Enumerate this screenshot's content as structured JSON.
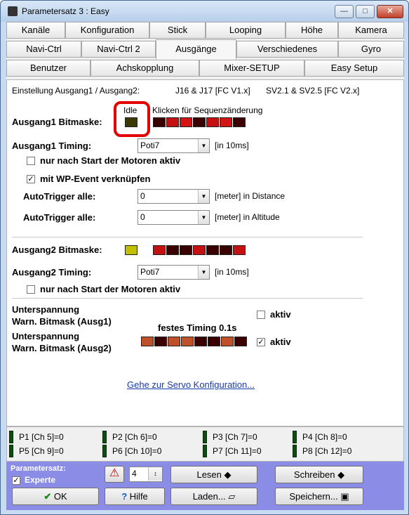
{
  "window": {
    "title": "Parametersatz 3 : Easy"
  },
  "tabs": {
    "row1": [
      "Kanäle",
      "Konfiguration",
      "Stick",
      "Looping",
      "Höhe",
      "Kamera"
    ],
    "row2": [
      "Navi-Ctrl",
      "Navi-Ctrl 2",
      "Ausgänge",
      "Verschiedenes",
      "Gyro"
    ],
    "row3": [
      "Benutzer",
      "Achskopplung",
      "Mixer-SETUP",
      "Easy Setup"
    ],
    "selected": "Ausgänge"
  },
  "panel": {
    "info_left": "Einstellung Ausgang1 / Ausgang2:",
    "info_mid": "J16 & J17 [FC V1.x]",
    "info_right": "SV2.1 & SV2.5 [FC V2.x]",
    "idle_label": "Idle",
    "seq_hint": "Klicken für Sequenzänderung",
    "a1_mask_label": "Ausgang1 Bitmaske:",
    "a1_timing_label": "Ausgang1 Timing:",
    "a1_timing_value": "Poti7",
    "timing_unit": "[in 10ms]",
    "a1_only_motors": "nur nach Start der Motoren aktiv",
    "a1_only_motors_checked": false,
    "wp_event": "mit WP-Event verknüpfen",
    "wp_event_checked": true,
    "autotrigger1_label": "AutoTrigger alle:",
    "autotrigger1_value": "0",
    "autotrigger1_unit": "[meter] in Distance",
    "autotrigger2_label": "AutoTrigger alle:",
    "autotrigger2_value": "0",
    "autotrigger2_unit": "[meter] in Altitude",
    "a2_mask_label": "Ausgang2 Bitmaske:",
    "a2_timing_label": "Ausgang2 Timing:",
    "a2_timing_value": "Poti7",
    "a2_only_motors": "nur nach Start der Motoren aktiv",
    "a2_only_motors_checked": false,
    "undervolt_label": "Unterspannung",
    "warn1_label": "Warn. Bitmask (Ausg1)",
    "aktiv1_label": "aktiv",
    "aktiv1_checked": false,
    "fixed_timing": "festes Timing 0.1s",
    "undervolt2_label": "Unterspannung",
    "warn2_label": "Warn. Bitmask (Ausg2)",
    "aktiv2_label": "aktiv",
    "aktiv2_checked": true,
    "servo_link": "Gehe zur Servo Konfiguration..."
  },
  "bitmask_colors": {
    "a1": [
      "#3a0000",
      "#c41010",
      "#d41414",
      "#3a0000",
      "#c41010",
      "#d41414",
      "#3a0000"
    ],
    "a2": [
      "#c41010",
      "#3a0000",
      "#3a0000",
      "#c41010",
      "#3a0000",
      "#3a0000",
      "#c41010"
    ],
    "warn": [
      "#c0502a",
      "#3a0000",
      "#c0502a",
      "#c0502a",
      "#3a0000",
      "#3a0000",
      "#c0502a",
      "#3a0000"
    ],
    "idle_a1": "#3a3a00",
    "idle_a2": "#c0c000"
  },
  "status": {
    "items": [
      "P1 [Ch 5]=0",
      "P2 [Ch 6]=0",
      "P3 [Ch 7]=0",
      "P4 [Ch 8]=0",
      "P5 [Ch 9]=0",
      "P6 [Ch 10]=0",
      "P7 [Ch 11]=0",
      "P8 [Ch 12]=0"
    ]
  },
  "bottom": {
    "param_label": "Parametersatz:",
    "expert_label": "Experte",
    "expert_checked": true,
    "set_value": "4",
    "read": "Lesen",
    "write": "Schreiben",
    "ok": "OK",
    "help": "Hilfe",
    "load": "Laden...",
    "save": "Speichern..."
  }
}
